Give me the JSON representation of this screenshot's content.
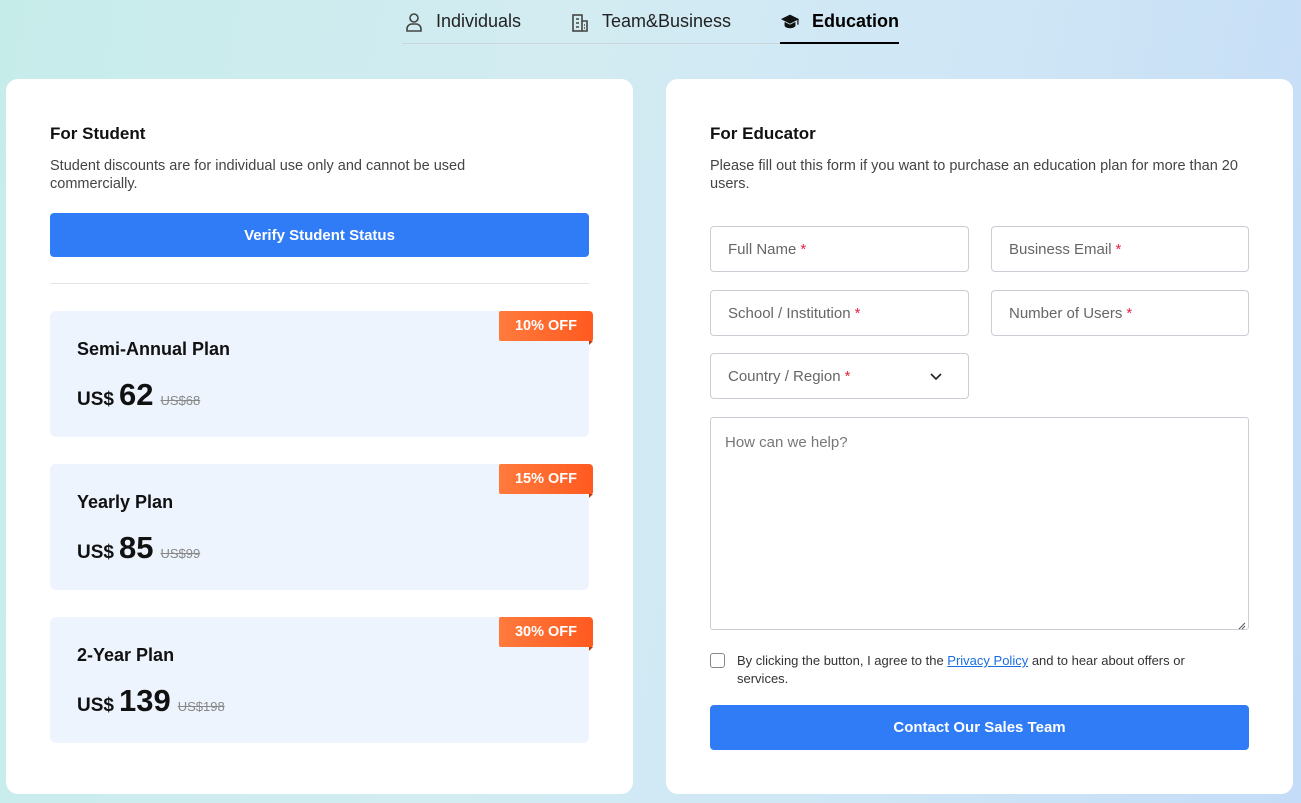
{
  "tabs": [
    {
      "label": "Individuals",
      "icon": "person-icon",
      "active": false
    },
    {
      "label": "Team&Business",
      "icon": "building-icon",
      "active": false
    },
    {
      "label": "Education",
      "icon": "graduation-cap-icon",
      "active": true
    }
  ],
  "student": {
    "title": "For Student",
    "description": "Student discounts are for individual use only and cannot be used commercially.",
    "verify_label": "Verify Student Status",
    "plans": [
      {
        "name": "Semi-Annual Plan",
        "currency": "US$",
        "price": "62",
        "old_price": "US$68",
        "badge": "10% OFF"
      },
      {
        "name": "Yearly Plan",
        "currency": "US$",
        "price": "85",
        "old_price": "US$99",
        "badge": "15% OFF"
      },
      {
        "name": "2-Year Plan",
        "currency": "US$",
        "price": "139",
        "old_price": "US$198",
        "badge": "30% OFF"
      }
    ]
  },
  "educator": {
    "title": "For Educator",
    "description": "Please fill out this form if you want to purchase an education plan for more than 20 users.",
    "fields": {
      "full_name": "Full Name",
      "business_email": "Business Email",
      "school": "School / Institution",
      "users": "Number of Users",
      "country": "Country / Region"
    },
    "required_mark": "*",
    "help_placeholder": "How can we help?",
    "consent_before": "By clicking the button, I agree to the ",
    "consent_link": "Privacy Policy",
    "consent_after": " and to hear about offers or services.",
    "contact_label": "Contact Our Sales Team"
  },
  "colors": {
    "primary": "#2f7cf6",
    "badge": "#ff5a1f",
    "required": "#e5253c",
    "plan_bg": "#edf4fe"
  }
}
